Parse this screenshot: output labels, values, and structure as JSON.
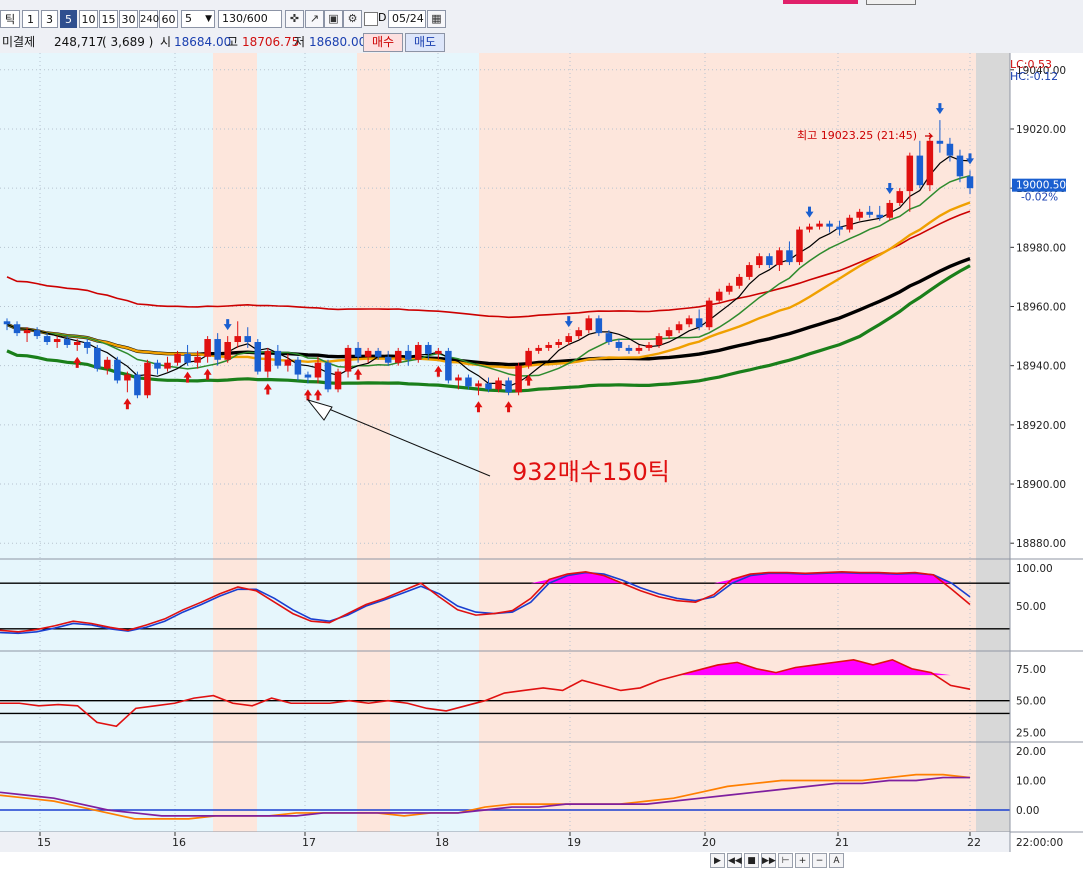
{
  "toolbar": {
    "tick_label": "틱",
    "intervals": [
      "1",
      "3",
      "5",
      "10",
      "15",
      "30",
      "240",
      "60"
    ],
    "selected_interval": "5",
    "period_value": "5",
    "count_value": "130",
    "count_total": "/600",
    "d_label": "D",
    "date_value": "05/24"
  },
  "info": {
    "open_interest_label": "미결제",
    "open_interest_value": "248,717",
    "open_interest_change": "( 3,689 )",
    "open_label": "시",
    "open_value": "18684.00",
    "high_label": "고",
    "high_value": "18706.75",
    "low_label": "저",
    "low_value": "18680.00",
    "buy_label": "매수",
    "sell_label": "매도"
  },
  "colors": {
    "up": "#e01010",
    "down": "#1a5fd0",
    "shade_blue": "#e6f6fc",
    "shade_pink": "#fde6dc",
    "envelope": "#cc0000",
    "ma_fast": "#000000",
    "ma_mid": "#2e8b2e",
    "ma_slow": "#f0a000",
    "ma_long": "#000000",
    "ma_green_thick": "#1a7f1a",
    "fill_magenta": "#ff00ff",
    "stoch_red": "#e01010",
    "stoch_blue": "#1a3fd0",
    "macd_orange": "#ff7f00",
    "macd_purple": "#7f1f9f"
  },
  "chart_data": [
    {
      "type": "candlestick",
      "panel": "price",
      "y_ticks": [
        "19040.00",
        "19020.00",
        "19000.00",
        "18980.00",
        "18960.00",
        "18940.00",
        "18920.00",
        "18900.00",
        "18880.00"
      ],
      "ylim": [
        18875,
        19045
      ],
      "x_ticks": [
        "15",
        "16",
        "17",
        "18",
        "19",
        "20",
        "21",
        "22"
      ],
      "corner_labels": [
        "LC:0.53",
        "HC:-0.12"
      ],
      "current_price": "19000.50",
      "current_change": "-0.02%",
      "high_annotation": "최고 19023.25 (21:45)",
      "annotation_text": "932매수150틱",
      "candles": [
        [
          18955,
          18956,
          18952,
          18954
        ],
        [
          18954,
          18955,
          18950,
          18951
        ],
        [
          18951,
          18953,
          18948,
          18952
        ],
        [
          18952,
          18953,
          18949,
          18950
        ],
        [
          18950,
          18951,
          18947,
          18948
        ],
        [
          18948,
          18950,
          18946,
          18949
        ],
        [
          18949,
          18950,
          18946,
          18947
        ],
        [
          18947,
          18949,
          18945,
          18948
        ],
        [
          18948,
          18949,
          18944,
          18946
        ],
        [
          18946,
          18947,
          18938,
          18939
        ],
        [
          18939,
          18943,
          18937,
          18942
        ],
        [
          18942,
          18943,
          18934,
          18935
        ],
        [
          18935,
          18938,
          18931,
          18937
        ],
        [
          18937,
          18938,
          18929,
          18930
        ],
        [
          18930,
          18942,
          18929,
          18941
        ],
        [
          18941,
          18942,
          18937,
          18939
        ],
        [
          18939,
          18943,
          18938,
          18941
        ],
        [
          18941,
          18945,
          18940,
          18944
        ],
        [
          18944,
          18947,
          18940,
          18941
        ],
        [
          18941,
          18945,
          18939,
          18943
        ],
        [
          18943,
          18950,
          18941,
          18949
        ],
        [
          18949,
          18951,
          18940,
          18942
        ],
        [
          18942,
          18950,
          18941,
          18948
        ],
        [
          18948,
          18955,
          18946,
          18950
        ],
        [
          18950,
          18953,
          18946,
          18948
        ],
        [
          18948,
          18949,
          18937,
          18938
        ],
        [
          18938,
          18946,
          18936,
          18945
        ],
        [
          18945,
          18947,
          18939,
          18940
        ],
        [
          18940,
          18944,
          18938,
          18942
        ],
        [
          18942,
          18943,
          18935,
          18937
        ],
        [
          18937,
          18938,
          18934,
          18936
        ],
        [
          18936,
          18943,
          18934,
          18941
        ],
        [
          18941,
          18942,
          18931,
          18932
        ],
        [
          18932,
          18939,
          18931,
          18938
        ],
        [
          18938,
          18947,
          18936,
          18946
        ],
        [
          18946,
          18948,
          18941,
          18943
        ],
        [
          18943,
          18946,
          18941,
          18945
        ],
        [
          18945,
          18946,
          18942,
          18943
        ],
        [
          18943,
          18945,
          18940,
          18941
        ],
        [
          18941,
          18946,
          18940,
          18945
        ],
        [
          18945,
          18947,
          18940,
          18942
        ],
        [
          18942,
          18948,
          18941,
          18947
        ],
        [
          18947,
          18948,
          18942,
          18944
        ],
        [
          18944,
          18946,
          18942,
          18945
        ],
        [
          18945,
          18946,
          18934,
          18935
        ],
        [
          18935,
          18937,
          18932,
          18936
        ],
        [
          18936,
          18937,
          18932,
          18933
        ],
        [
          18933,
          18935,
          18930,
          18934
        ],
        [
          18934,
          18936,
          18931,
          18932
        ],
        [
          18932,
          18936,
          18931,
          18935
        ],
        [
          18935,
          18936,
          18930,
          18931
        ],
        [
          18931,
          18941,
          18930,
          18940
        ],
        [
          18940,
          18946,
          18939,
          18945
        ],
        [
          18945,
          18947,
          18944,
          18946
        ],
        [
          18946,
          18948,
          18945,
          18947
        ],
        [
          18947,
          18949,
          18946,
          18948
        ],
        [
          18948,
          18951,
          18947,
          18950
        ],
        [
          18950,
          18953,
          18949,
          18952
        ],
        [
          18952,
          18957,
          18951,
          18956
        ],
        [
          18956,
          18957,
          18950,
          18951
        ],
        [
          18951,
          18952,
          18947,
          18948
        ],
        [
          18948,
          18949,
          18945,
          18946
        ],
        [
          18946,
          18947,
          18944,
          18945
        ],
        [
          18945,
          18947,
          18944,
          18946
        ],
        [
          18946,
          18948,
          18945,
          18947
        ],
        [
          18947,
          18951,
          18946,
          18950
        ],
        [
          18950,
          18953,
          18949,
          18952
        ],
        [
          18952,
          18955,
          18951,
          18954
        ],
        [
          18954,
          18957,
          18953,
          18956
        ],
        [
          18956,
          18959,
          18952,
          18953
        ],
        [
          18953,
          18963,
          18952,
          18962
        ],
        [
          18962,
          18966,
          18961,
          18965
        ],
        [
          18965,
          18968,
          18964,
          18967
        ],
        [
          18967,
          18971,
          18966,
          18970
        ],
        [
          18970,
          18975,
          18969,
          18974
        ],
        [
          18974,
          18978,
          18973,
          18977
        ],
        [
          18977,
          18978,
          18973,
          18974
        ],
        [
          18974,
          18980,
          18972,
          18979
        ],
        [
          18979,
          18982,
          18974,
          18975
        ],
        [
          18975,
          18987,
          18974,
          18986
        ],
        [
          18986,
          18988,
          18985,
          18987
        ],
        [
          18987,
          18989,
          18986,
          18988
        ],
        [
          18988,
          18989,
          18985,
          18987
        ],
        [
          18987,
          18989,
          18984,
          18986
        ],
        [
          18986,
          18991,
          18985,
          18990
        ],
        [
          18990,
          18993,
          18989,
          18992
        ],
        [
          18992,
          18994,
          18990,
          18991
        ],
        [
          18991,
          18994,
          18989,
          18990
        ],
        [
          18990,
          18996,
          18989,
          18995
        ],
        [
          18995,
          19000,
          18994,
          18999
        ],
        [
          18999,
          19012,
          18992,
          19011
        ],
        [
          19011,
          19016,
          19000,
          19001
        ],
        [
          19001,
          19018,
          18999,
          19016
        ],
        [
          19016,
          19023,
          19012,
          19015
        ],
        [
          19015,
          19017,
          19009,
          19011
        ],
        [
          19011,
          19013,
          19002,
          19004
        ],
        [
          19004,
          19006,
          18998,
          19000
        ]
      ]
    },
    {
      "type": "line",
      "panel": "stochastic",
      "y_ticks": [
        "100.00",
        "50.00"
      ],
      "levels": [
        80,
        20
      ],
      "series": [
        {
          "values": [
            18,
            16,
            19,
            24,
            30,
            27,
            22,
            18,
            25,
            33,
            45,
            55,
            66,
            75,
            70,
            55,
            40,
            30,
            28,
            40,
            52,
            60,
            70,
            80,
            62,
            45,
            38,
            40,
            44,
            60,
            85,
            92,
            95,
            90,
            80,
            70,
            62,
            57,
            55,
            65,
            85,
            92,
            94,
            94,
            93,
            94,
            95,
            94,
            94,
            93,
            94,
            91,
            72,
            52
          ]
        },
        {
          "values": [
            15,
            14,
            16,
            21,
            27,
            25,
            20,
            17,
            22,
            30,
            42,
            52,
            63,
            72,
            72,
            60,
            45,
            33,
            30,
            38,
            50,
            58,
            67,
            76,
            66,
            50,
            42,
            40,
            42,
            55,
            80,
            90,
            94,
            92,
            84,
            74,
            66,
            60,
            57,
            62,
            80,
            90,
            93,
            93,
            92,
            93,
            94,
            93,
            93,
            92,
            93,
            91,
            80,
            62
          ]
        }
      ]
    },
    {
      "type": "area",
      "panel": "rsi",
      "y_ticks": [
        "75.00",
        "50.00",
        "25.00"
      ],
      "levels": [
        50,
        40
      ],
      "series": [
        {
          "values": [
            48,
            48,
            46,
            47,
            46,
            33,
            30,
            44,
            46,
            48,
            52,
            54,
            48,
            46,
            52,
            48,
            48,
            48,
            50,
            48,
            50,
            48,
            44,
            42,
            46,
            50,
            56,
            58,
            60,
            58,
            66,
            62,
            58,
            60,
            66,
            70,
            74,
            78,
            80,
            75,
            72,
            76,
            78,
            80,
            82,
            78,
            82,
            75,
            72,
            62,
            59
          ]
        }
      ]
    },
    {
      "type": "line",
      "panel": "macd",
      "y_ticks": [
        "20.00",
        "10.00",
        "0.00"
      ],
      "series": [
        {
          "values": [
            5,
            4,
            3,
            1,
            -1,
            -3,
            -3,
            -3,
            -2,
            -2,
            -2,
            -1,
            -1,
            -1,
            -1,
            -2,
            -1,
            -1,
            1,
            2,
            2,
            2,
            2,
            2,
            3,
            4,
            6,
            8,
            9,
            10,
            10,
            10,
            10,
            11,
            12,
            12,
            11
          ]
        },
        {
          "values": [
            6,
            5,
            4,
            2,
            0,
            -1,
            -2,
            -2,
            -2,
            -2,
            -2,
            -2,
            -1,
            -1,
            -1,
            -1,
            -1,
            -1,
            0,
            1,
            1,
            2,
            2,
            2,
            2,
            3,
            4,
            5,
            6,
            7,
            8,
            9,
            9,
            10,
            10,
            11,
            11
          ]
        }
      ]
    }
  ],
  "time_labels": [
    "22:00:00"
  ],
  "navbar": {
    "items": [
      "▶",
      "◀◀",
      "■",
      "▶▶",
      "⊢",
      "+",
      "−",
      "A"
    ]
  }
}
